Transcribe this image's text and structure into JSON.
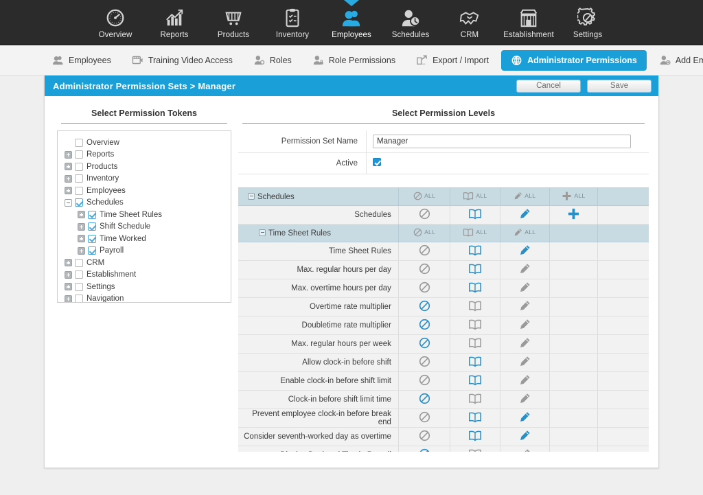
{
  "topnav": {
    "items": [
      {
        "label": "Overview",
        "icon": "gauge-icon",
        "active": false
      },
      {
        "label": "Reports",
        "icon": "chart-growth-icon",
        "active": false
      },
      {
        "label": "Products",
        "icon": "shopping-cart-icon",
        "active": false
      },
      {
        "label": "Inventory",
        "icon": "clipboard-checklist-icon",
        "active": false
      },
      {
        "label": "Employees",
        "icon": "people-icon",
        "active": true
      },
      {
        "label": "Schedules",
        "icon": "person-clock-icon",
        "active": false
      },
      {
        "label": "CRM",
        "icon": "handshake-icon",
        "active": false
      },
      {
        "label": "Establishment",
        "icon": "storefront-icon",
        "active": false
      },
      {
        "label": "Settings",
        "icon": "gear-icon",
        "active": false
      }
    ]
  },
  "subnav": {
    "items": [
      {
        "label": "Employees",
        "icon": "people-icon",
        "active": false
      },
      {
        "label": "Training Video Access",
        "icon": "video-icon",
        "active": false
      },
      {
        "label": "Roles",
        "icon": "person-badge-icon",
        "active": false
      },
      {
        "label": "Role Permissions",
        "icon": "person-lock-icon",
        "active": false
      },
      {
        "label": "Export / Import",
        "icon": "export-icon",
        "active": false
      },
      {
        "label": "Administrator Permissions",
        "icon": "globe-icon",
        "active": true
      },
      {
        "label": "Add Employee",
        "icon": "person-add-icon",
        "active": false
      }
    ]
  },
  "header": {
    "breadcrumb_root": "Administrator Permission Sets",
    "breadcrumb_sep": ">",
    "breadcrumb_current": "Manager",
    "title": "Administrator Permission Sets  >  Manager",
    "cancel_label": "Cancel",
    "save_label": "Save"
  },
  "left_panel": {
    "title": "Select Permission Tokens",
    "tree": [
      {
        "label": "Overview",
        "expander": "none",
        "checked": false,
        "depth": 0
      },
      {
        "label": "Reports",
        "expander": "plus",
        "checked": false,
        "depth": 0
      },
      {
        "label": "Products",
        "expander": "plus",
        "checked": false,
        "depth": 0
      },
      {
        "label": "Inventory",
        "expander": "plus",
        "checked": false,
        "depth": 0
      },
      {
        "label": "Employees",
        "expander": "plus",
        "checked": false,
        "depth": 0
      },
      {
        "label": "Schedules",
        "expander": "minus",
        "checked": true,
        "depth": 0
      },
      {
        "label": "Time Sheet Rules",
        "expander": "plus",
        "checked": true,
        "depth": 1
      },
      {
        "label": "Shift Schedule",
        "expander": "plus",
        "checked": true,
        "depth": 1
      },
      {
        "label": "Time Worked",
        "expander": "plus",
        "checked": true,
        "depth": 1
      },
      {
        "label": "Payroll",
        "expander": "plus",
        "checked": true,
        "depth": 1
      },
      {
        "label": "CRM",
        "expander": "plus",
        "checked": false,
        "depth": 0
      },
      {
        "label": "Establishment",
        "expander": "plus",
        "checked": false,
        "depth": 0
      },
      {
        "label": "Settings",
        "expander": "plus",
        "checked": false,
        "depth": 0
      },
      {
        "label": "Navigation",
        "expander": "plus",
        "checked": false,
        "depth": 0
      }
    ]
  },
  "right_panel": {
    "title": "Select Permission Levels",
    "fields": [
      {
        "label": "Permission Set Name",
        "type": "text",
        "value": "Manager",
        "placeholder": ""
      },
      {
        "label": "Active",
        "type": "checkbox",
        "value": true
      }
    ],
    "all_label": "ALL",
    "columns": [
      "none",
      "view",
      "edit",
      "add",
      "empty"
    ],
    "rows": [
      {
        "kind": "group",
        "label": "Schedules",
        "depth": 0,
        "expander": "minus",
        "all": [
          "none",
          "view",
          "edit",
          "add"
        ]
      },
      {
        "kind": "row",
        "label": "Schedules",
        "states": {
          "none": "off",
          "view": "on",
          "edit": "on",
          "add": "on"
        }
      },
      {
        "kind": "group",
        "label": "Time Sheet Rules",
        "depth": 1,
        "expander": "minus",
        "all": [
          "none",
          "view",
          "edit"
        ]
      },
      {
        "kind": "row",
        "label": "Time Sheet Rules",
        "states": {
          "none": "off",
          "view": "on",
          "edit": "on",
          "add": "none"
        }
      },
      {
        "kind": "row",
        "label": "Max. regular hours per day",
        "states": {
          "none": "off",
          "view": "on",
          "edit": "off",
          "add": "none"
        }
      },
      {
        "kind": "row",
        "label": "Max. overtime hours per day",
        "states": {
          "none": "off",
          "view": "on",
          "edit": "off",
          "add": "none"
        }
      },
      {
        "kind": "row",
        "label": "Overtime rate multiplier",
        "states": {
          "none": "on",
          "view": "off",
          "edit": "off",
          "add": "none"
        }
      },
      {
        "kind": "row",
        "label": "Doubletime rate multiplier",
        "states": {
          "none": "on",
          "view": "off",
          "edit": "off",
          "add": "none"
        }
      },
      {
        "kind": "row",
        "label": "Max. regular hours per week",
        "states": {
          "none": "on",
          "view": "off",
          "edit": "off",
          "add": "none"
        }
      },
      {
        "kind": "row",
        "label": "Allow clock-in before shift",
        "states": {
          "none": "off",
          "view": "on",
          "edit": "off",
          "add": "none"
        }
      },
      {
        "kind": "row",
        "label": "Enable clock-in before shift limit",
        "states": {
          "none": "off",
          "view": "on",
          "edit": "off",
          "add": "none"
        }
      },
      {
        "kind": "row",
        "label": "Clock-in before shift limit time",
        "states": {
          "none": "on",
          "view": "off",
          "edit": "off",
          "add": "none"
        }
      },
      {
        "kind": "row",
        "label": "Prevent employee clock-in before break end",
        "states": {
          "none": "off",
          "view": "on",
          "edit": "on",
          "add": "none"
        }
      },
      {
        "kind": "row",
        "label": "Consider seventh-worked day as overtime",
        "states": {
          "none": "off",
          "view": "on",
          "edit": "on",
          "add": "none"
        }
      },
      {
        "kind": "row",
        "label": "Display Declared Tips in Payroll",
        "states": {
          "none": "on",
          "view": "off",
          "edit": "off",
          "add": "none"
        }
      }
    ]
  },
  "colors": {
    "accent": "#1b9fd8",
    "icon_active": "#2a8fc4",
    "icon_inactive": "#9a9a9a",
    "topnav_bg": "#2b2b2b",
    "group_row_bg": "#c8dbe3",
    "row_bg": "#f2f2f2"
  }
}
